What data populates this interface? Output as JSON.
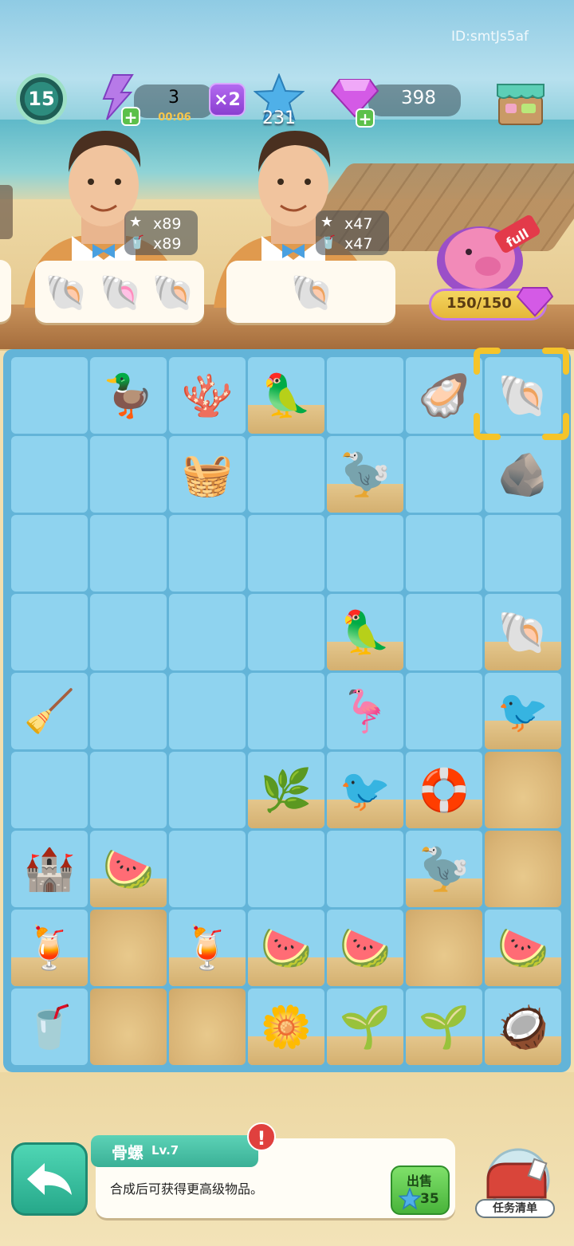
{
  "watermark": "ID:smtJs5af",
  "hud": {
    "level": "15",
    "energy": {
      "value": "3",
      "timer": "00:06",
      "plus": "+"
    },
    "multiplier": "×2",
    "stars": "231",
    "gems": {
      "value": "398",
      "plus": "+"
    },
    "shop_icon": "shop-stall-icon"
  },
  "customers": [
    {
      "requests": [
        {
          "icon": "star-icon",
          "count": "x89"
        },
        {
          "icon": "juice-icon",
          "count": "x89"
        }
      ],
      "wanted_items": [
        "green-conch-icon",
        "pink-shell-icon",
        "spiral-shell-icon"
      ]
    },
    {
      "requests": [
        {
          "icon": "star-icon",
          "count": "x47"
        },
        {
          "icon": "juice-icon",
          "count": "x47"
        }
      ],
      "wanted_items": [
        "spiral-shell-icon"
      ]
    }
  ],
  "piggy_bank": {
    "value": "150/150",
    "tag": "full"
  },
  "board": {
    "columns": 7,
    "rows": 9,
    "cells": [
      [
        "",
        "🦆",
        "🪸",
        "🦜",
        "",
        "🦪",
        "🐚"
      ],
      [
        "",
        "",
        "🧺",
        "",
        "🦤",
        "",
        "🪨"
      ],
      [
        "",
        "",
        "",
        "",
        "",
        "",
        ""
      ],
      [
        "",
        "",
        "",
        "",
        "🦜",
        "",
        "🐚"
      ],
      [
        "🧹",
        "",
        "",
        "",
        "🦩",
        "",
        "🐦"
      ],
      [
        "",
        "",
        "",
        "🌿",
        "🐦",
        "🛟",
        "sand"
      ],
      [
        "🏰",
        "🍉",
        "",
        "",
        "",
        "🦤",
        "sand"
      ],
      [
        "🍹",
        "sand",
        "🍹",
        "🍉",
        "🍉",
        "sand",
        "🍉"
      ],
      [
        "🥤",
        "sand",
        "sand",
        "🌼",
        "🌱",
        "🌱",
        "🥥"
      ]
    ],
    "sand_base": [
      [
        false,
        false,
        false,
        true,
        false,
        false,
        false
      ],
      [
        false,
        false,
        false,
        false,
        true,
        false,
        false
      ],
      [
        false,
        false,
        false,
        false,
        false,
        false,
        false
      ],
      [
        false,
        false,
        false,
        false,
        true,
        false,
        true
      ],
      [
        false,
        false,
        false,
        false,
        false,
        false,
        true
      ],
      [
        false,
        false,
        false,
        true,
        true,
        true,
        true
      ],
      [
        false,
        true,
        false,
        false,
        false,
        true,
        true
      ],
      [
        true,
        true,
        true,
        true,
        true,
        true,
        true
      ],
      [
        false,
        true,
        true,
        true,
        true,
        true,
        true
      ]
    ]
  },
  "info_panel": {
    "name": "骨螺",
    "level": "Lv.7",
    "description": "合成后可获得更高级物品。",
    "sell_label": "出售",
    "sell_price": "35"
  },
  "task_button_label": "任务清单",
  "colors": {
    "board": "#63b4d8",
    "cell": "#8fd3ef",
    "accent": "#3ab096",
    "selector": "#f5c42a"
  }
}
